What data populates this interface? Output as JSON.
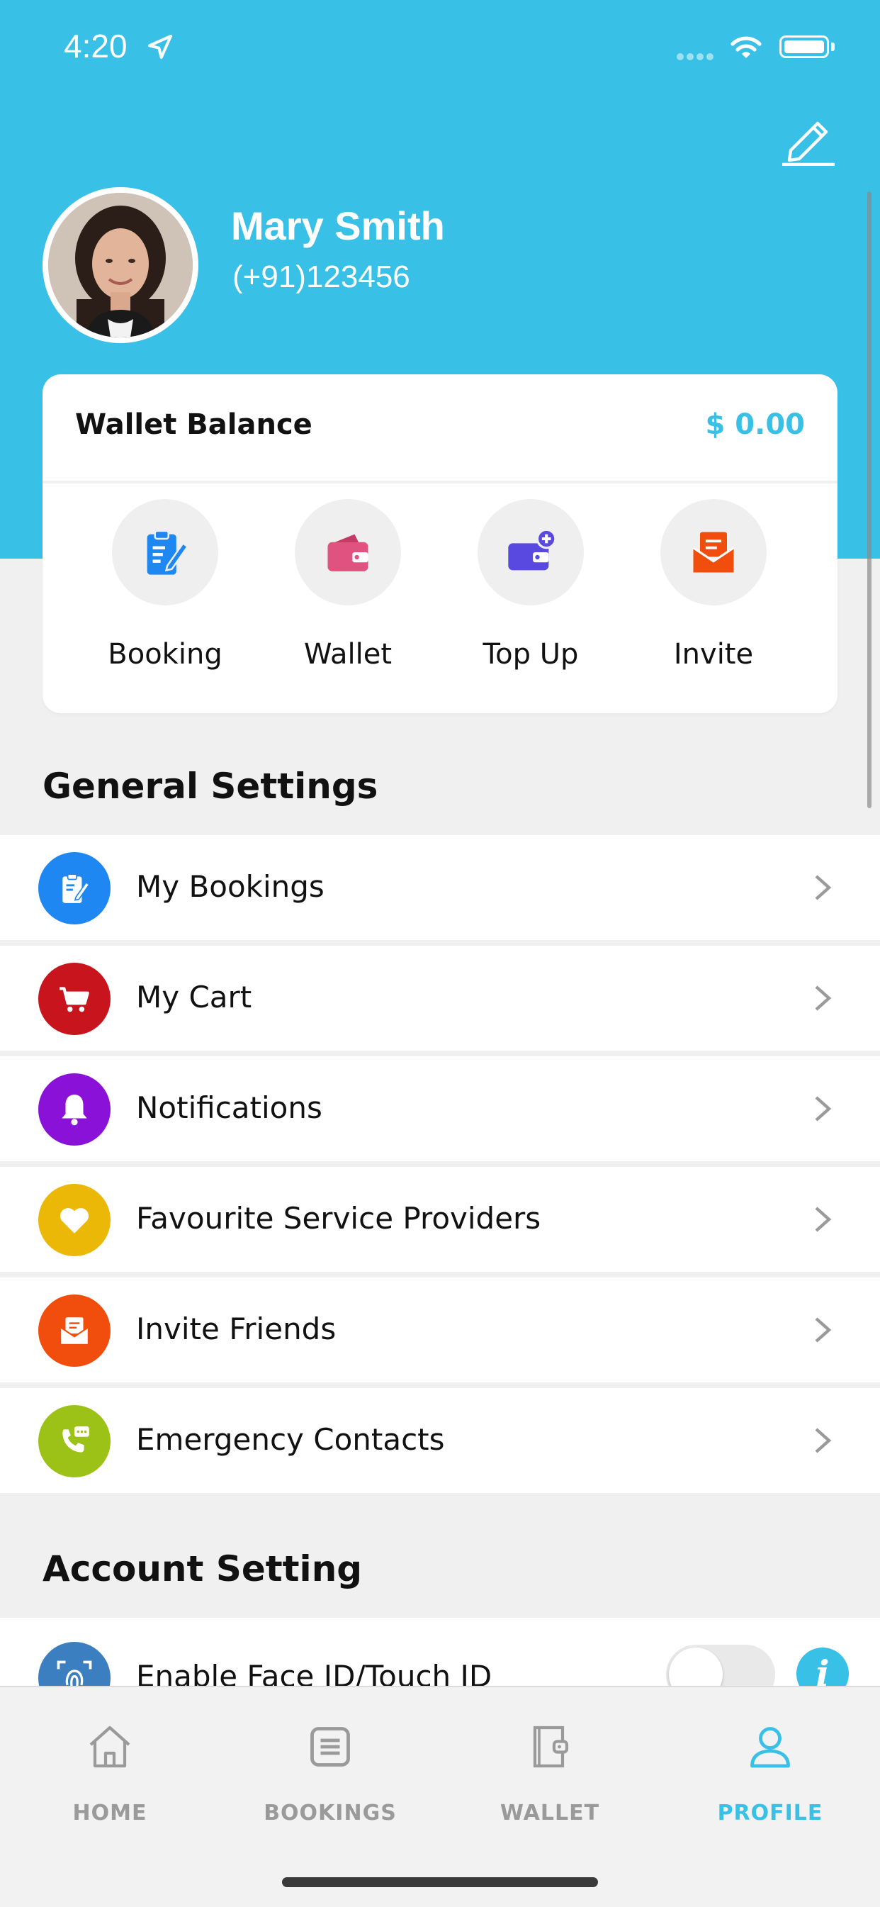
{
  "status_bar": {
    "time": "4:20"
  },
  "profile": {
    "name": "Mary Smith",
    "phone": "(+91)123456"
  },
  "wallet": {
    "title": "Wallet Balance",
    "amount": "$ 0.00",
    "actions": [
      {
        "label": "Booking",
        "icon": "booking-clipboard-icon"
      },
      {
        "label": "Wallet",
        "icon": "wallet-icon"
      },
      {
        "label": "Top Up",
        "icon": "wallet-add-icon"
      },
      {
        "label": "Invite",
        "icon": "invite-envelope-icon"
      }
    ]
  },
  "general_settings": {
    "title": "General Settings",
    "items": [
      {
        "label": "My Bookings",
        "icon": "booking-clipboard-icon",
        "color": "#1f87f2"
      },
      {
        "label": "My Cart",
        "icon": "cart-icon",
        "color": "#c8151d"
      },
      {
        "label": "Notifications",
        "icon": "bell-icon",
        "color": "#8a12d8"
      },
      {
        "label": "Favourite Service Providers",
        "icon": "heart-icon",
        "color": "#ebb808"
      },
      {
        "label": "Invite Friends",
        "icon": "invite-envelope-icon",
        "color": "#f14e0d"
      },
      {
        "label": "Emergency Contacts",
        "icon": "phone-chat-icon",
        "color": "#9cc218"
      }
    ]
  },
  "account_setting": {
    "title": "Account Setting",
    "face_id": {
      "label": "Enable Face ID/Touch ID",
      "enabled": false
    }
  },
  "tabbar": {
    "tabs": [
      {
        "label": "HOME",
        "icon": "home-icon"
      },
      {
        "label": "BOOKINGS",
        "icon": "list-icon"
      },
      {
        "label": "WALLET",
        "icon": "wallet-icon"
      },
      {
        "label": "PROFILE",
        "icon": "user-icon",
        "active": true
      }
    ]
  },
  "colors": {
    "accent": "#39c0e7",
    "background": "#f0f0f0"
  }
}
